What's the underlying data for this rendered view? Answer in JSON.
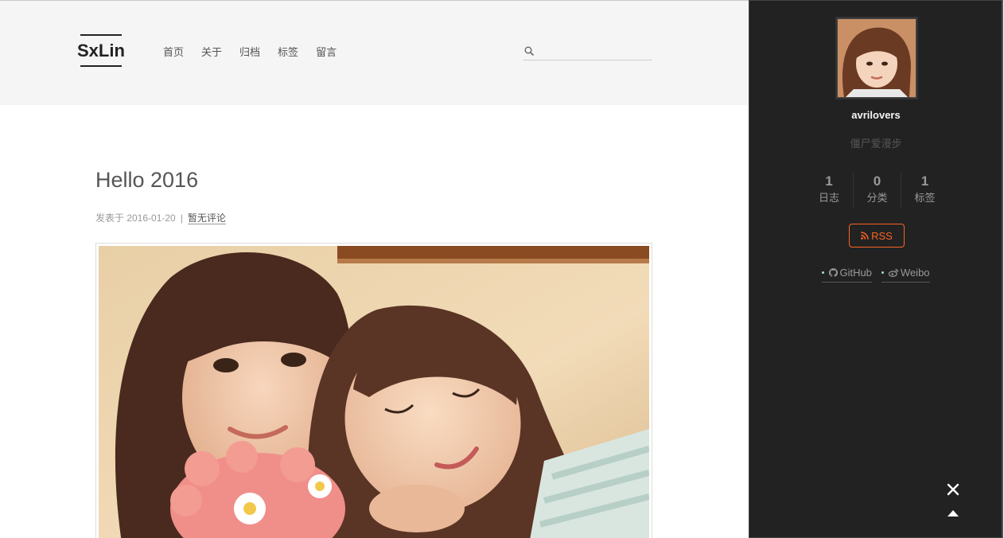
{
  "header": {
    "logo": "SxLin",
    "nav": [
      "首页",
      "关于",
      "归档",
      "标签",
      "留言"
    ],
    "search": {
      "placeholder": "",
      "value": "",
      "icon": "search-icon"
    }
  },
  "post": {
    "title": "Hello 2016",
    "meta": {
      "posted_label": "发表于 2016-01-20",
      "divider": "|",
      "comments": "暂无评论"
    },
    "image": "photo-two-girls"
  },
  "sidebar": {
    "author": "avrilovers",
    "description": "僵尸爱漫步",
    "stats": [
      {
        "count": "1",
        "label": "日志"
      },
      {
        "count": "0",
        "label": "分类"
      },
      {
        "count": "1",
        "label": "标签"
      }
    ],
    "rss": "RSS",
    "links": [
      {
        "label": "GitHub",
        "icon": "github-icon"
      },
      {
        "label": "Weibo",
        "icon": "weibo-icon"
      }
    ]
  },
  "colors": {
    "accent": "#fc6423",
    "sidebar_bg": "#222222",
    "header_bg": "#f5f5f5"
  }
}
